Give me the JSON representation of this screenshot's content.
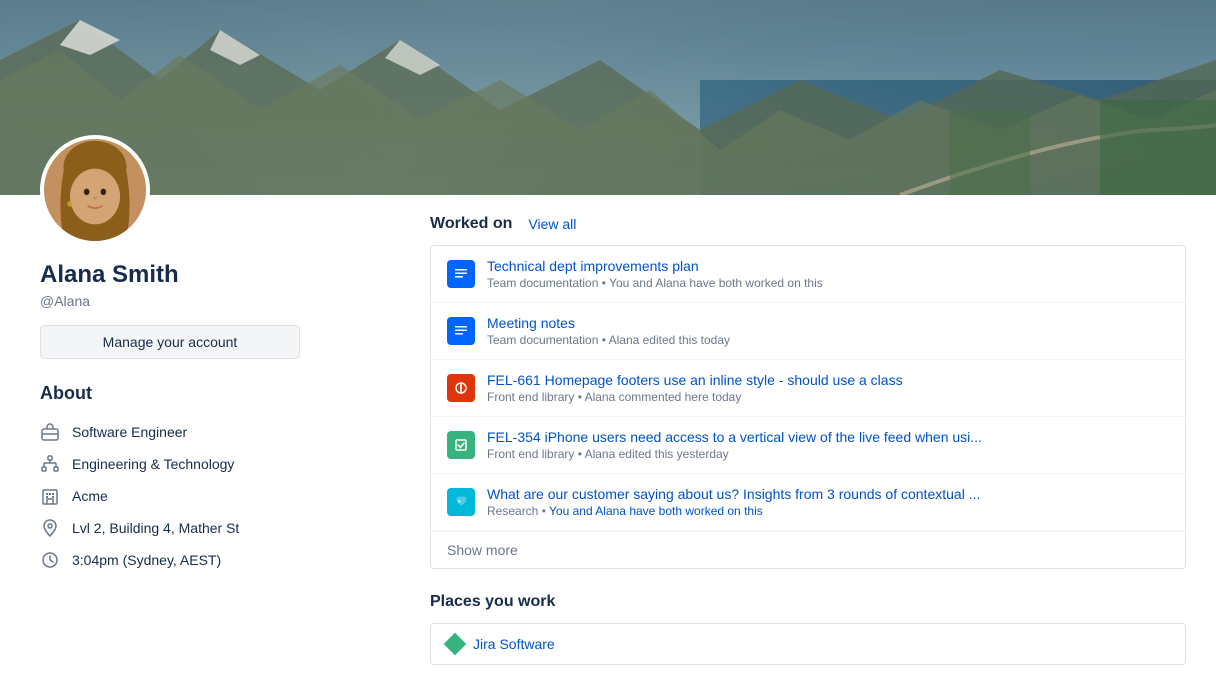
{
  "banner": {
    "alt": "Mountain landscape banner"
  },
  "user": {
    "name": "Alana Smith",
    "handle": "@Alana",
    "manage_label": "Manage your account"
  },
  "about": {
    "title": "About",
    "items": [
      {
        "id": "job-title",
        "icon": "briefcase",
        "text": "Software Engineer"
      },
      {
        "id": "department",
        "icon": "org-chart",
        "text": "Engineering & Technology"
      },
      {
        "id": "company",
        "icon": "building",
        "text": "Acme"
      },
      {
        "id": "location",
        "icon": "pin",
        "text": "Lvl 2, Building 4, Mather St"
      },
      {
        "id": "time",
        "icon": "clock",
        "text": "3:04pm (Sydney, AEST)"
      }
    ]
  },
  "worked_on": {
    "section_title": "Worked on",
    "view_all": "View all",
    "items": [
      {
        "icon_type": "blue",
        "icon_symbol": "≡",
        "title": "Technical dept improvements plan",
        "meta": "Team documentation • You and Alana have both worked on this"
      },
      {
        "icon_type": "blue",
        "icon_symbol": "≡",
        "title": "Meeting notes",
        "meta": "Team documentation • Alana edited this today"
      },
      {
        "icon_type": "red",
        "icon_symbol": "⊕",
        "title": "FEL-661 Homepage footers use an inline style - should use a class",
        "meta": "Front end library • Alana commented here today"
      },
      {
        "icon_type": "green",
        "icon_symbol": "☐",
        "title": "FEL-354 iPhone users need access to a vertical view of the live feed when usi...",
        "meta": "Front end library • Alana edited this yesterday"
      },
      {
        "icon_type": "teal",
        "icon_symbol": "\"",
        "title": "What are our customer saying about us? Insights from 3 rounds of contextual ...",
        "meta_prefix": "Research • ",
        "meta_link": "You and Alana have both worked on this"
      }
    ],
    "show_more": "Show more"
  },
  "places_you_work": {
    "title": "Places you work",
    "items": [
      {
        "name": "Jira Software"
      }
    ]
  }
}
